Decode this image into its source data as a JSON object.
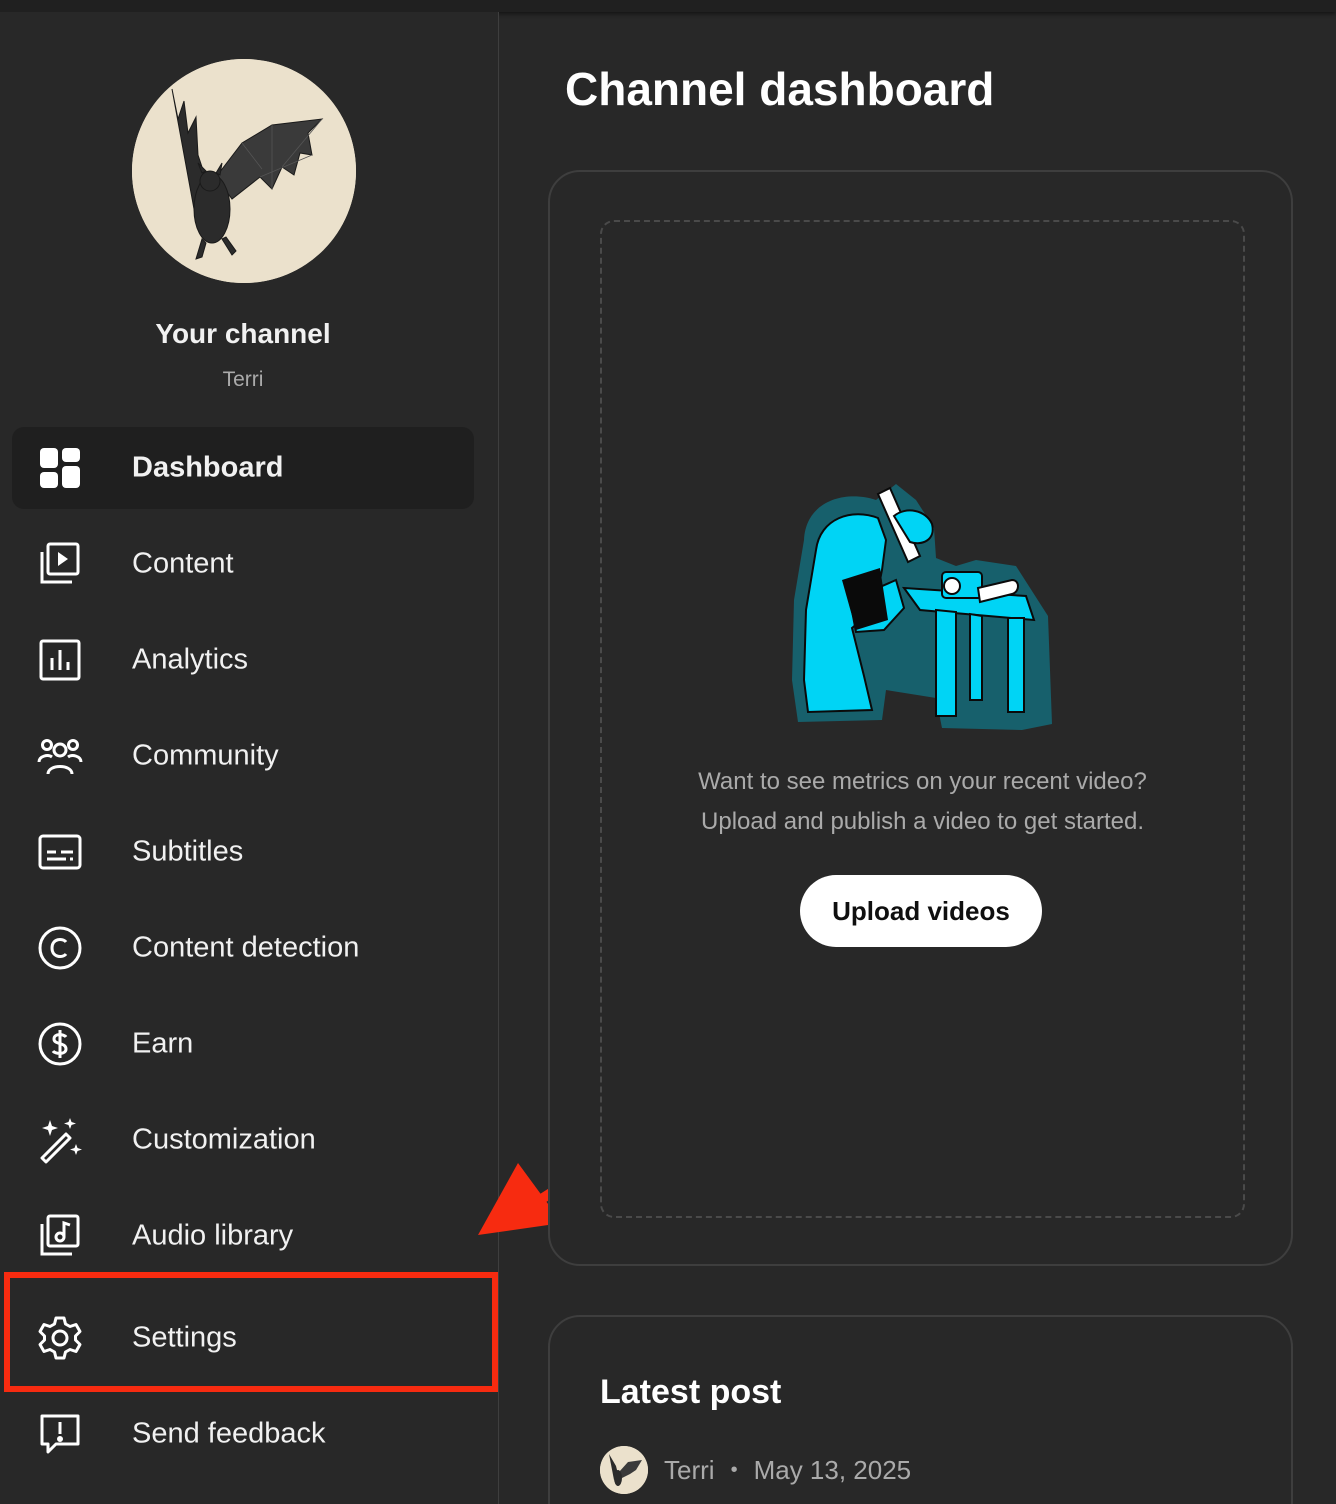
{
  "sidebar": {
    "channel_title": "Your channel",
    "channel_name": "Terri",
    "items": [
      {
        "label": "Dashboard",
        "icon": "dashboard-icon",
        "active": true
      },
      {
        "label": "Content",
        "icon": "content-icon"
      },
      {
        "label": "Analytics",
        "icon": "analytics-icon"
      },
      {
        "label": "Community",
        "icon": "community-icon"
      },
      {
        "label": "Subtitles",
        "icon": "subtitles-icon"
      },
      {
        "label": "Content detection",
        "icon": "copyright-icon"
      },
      {
        "label": "Earn",
        "icon": "dollar-icon"
      },
      {
        "label": "Customization",
        "icon": "magic-wand-icon"
      },
      {
        "label": "Audio library",
        "icon": "audio-library-icon"
      },
      {
        "label": "Settings",
        "icon": "gear-icon"
      },
      {
        "label": "Send feedback",
        "icon": "feedback-icon"
      }
    ]
  },
  "main": {
    "title": "Channel dashboard",
    "upload_card": {
      "line1": "Want to see metrics on your recent video?",
      "line2": "Upload and publish a video to get started.",
      "button_label": "Upload videos"
    },
    "latest_post": {
      "title": "Latest post",
      "author": "Terri",
      "separator": "•",
      "date": "May 13, 2025"
    }
  },
  "annotation": {
    "highlight_color": "#f72b10",
    "highlighted_item": "Settings"
  },
  "colors": {
    "background": "#282828",
    "text": "#f1f1f1",
    "muted": "#aaaaaa",
    "accent": "#00d4f5"
  }
}
